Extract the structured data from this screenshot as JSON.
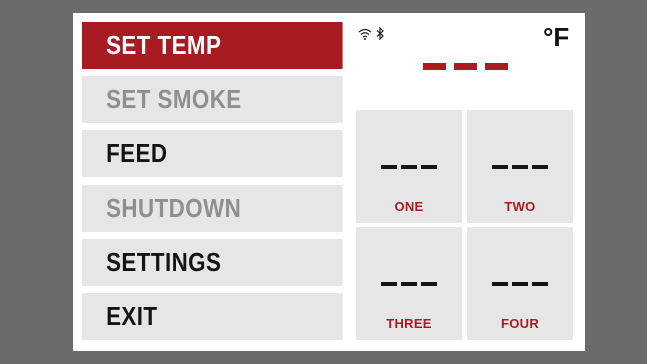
{
  "menu": {
    "items": [
      {
        "label": "SET TEMP",
        "state": "selected"
      },
      {
        "label": "SET SMOKE",
        "state": "disabled"
      },
      {
        "label": "FEED",
        "state": "enabled"
      },
      {
        "label": "SHUTDOWN",
        "state": "disabled"
      },
      {
        "label": "SETTINGS",
        "state": "enabled"
      },
      {
        "label": "EXIT",
        "state": "enabled"
      }
    ]
  },
  "status": {
    "wifi_icon": "wifi-icon",
    "bluetooth_icon": "bluetooth-icon",
    "wifi_glyph": "ᯤ",
    "bluetooth_glyph": "✱"
  },
  "temperature": {
    "unit": "°F",
    "reading": "---"
  },
  "probes": [
    {
      "label": "ONE",
      "reading": "---"
    },
    {
      "label": "TWO",
      "reading": "---"
    },
    {
      "label": "THREE",
      "reading": "---"
    },
    {
      "label": "FOUR",
      "reading": "---"
    }
  ],
  "colors": {
    "accent": "#a91b23",
    "panel": "#e6e6e6",
    "bezel": "#6b6b6b"
  }
}
